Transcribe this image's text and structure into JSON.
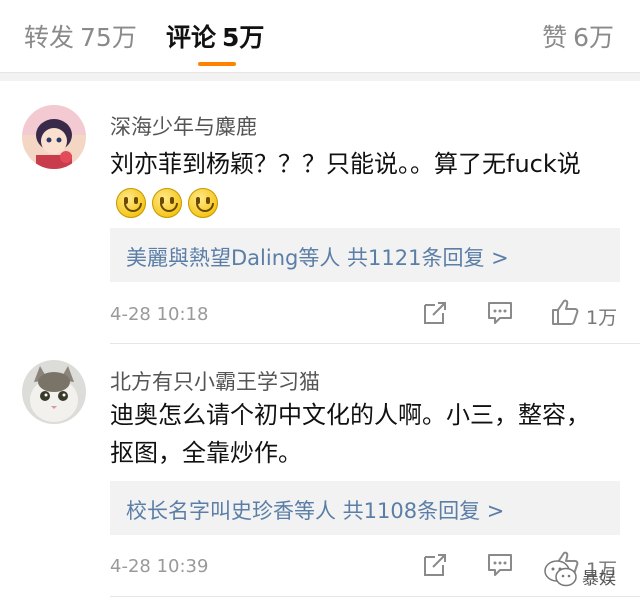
{
  "tabs": {
    "forward": {
      "label": "转发",
      "count": "75万"
    },
    "comments": {
      "label": "评论",
      "count": "5万"
    },
    "likes": {
      "label": "赞",
      "count": "6万"
    }
  },
  "colors": {
    "accent": "#ff8200",
    "link": "#5b7ea7"
  },
  "comments": [
    {
      "username": "深海少年与麋鹿",
      "text": "刘亦菲到杨颖？？？只能说。。算了无fuck说",
      "emoji": [
        "smile",
        "smile",
        "smile"
      ],
      "replies": "美麗與熱望Daling等人 共1121条回复 >",
      "time": "4-28 10:18",
      "likes": "1万"
    },
    {
      "username": "北方有只小霸王学习猫",
      "text": "迪奥怎么请个初中文化的人啊。小三，整容，抠图，全靠炒作。",
      "replies": "校长名字叫史珍香等人 共1108条回复 >",
      "time": "4-28 10:39",
      "likes": "1万"
    }
  ],
  "watermark": "暴娱"
}
